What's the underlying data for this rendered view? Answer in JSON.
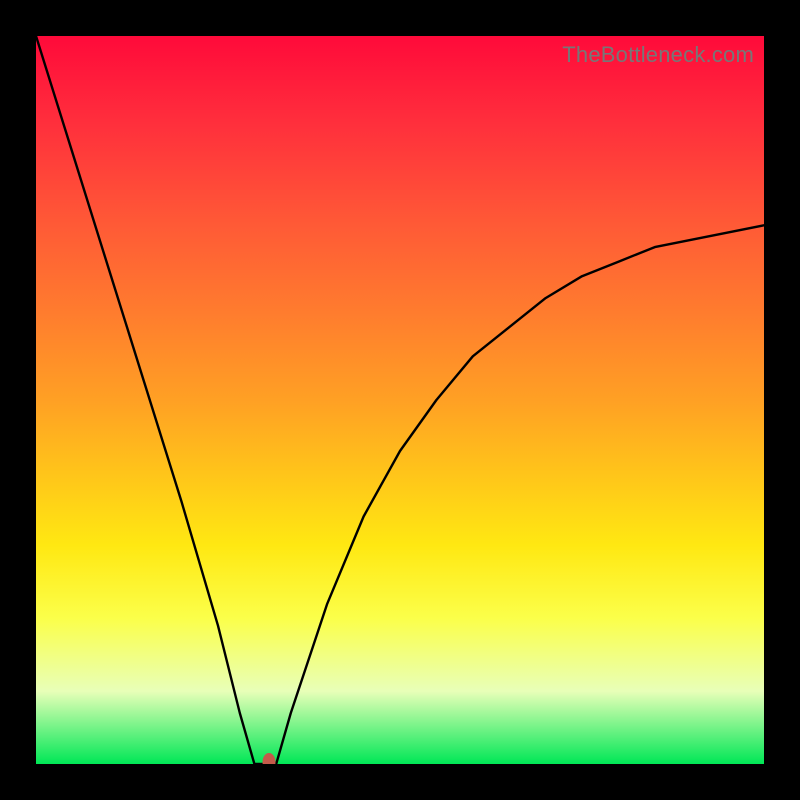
{
  "watermark": "TheBottleneck.com",
  "chart_data": {
    "type": "line",
    "title": "",
    "xlabel": "",
    "ylabel": "",
    "xlim": [
      0,
      1
    ],
    "ylim": [
      0,
      1
    ],
    "x": [
      0.0,
      0.05,
      0.1,
      0.15,
      0.2,
      0.25,
      0.28,
      0.3,
      0.31,
      0.33,
      0.35,
      0.4,
      0.45,
      0.5,
      0.55,
      0.6,
      0.65,
      0.7,
      0.75,
      0.8,
      0.85,
      0.9,
      0.95,
      1.0
    ],
    "y": [
      1.0,
      0.84,
      0.68,
      0.52,
      0.36,
      0.19,
      0.07,
      0.0,
      0.0,
      0.0,
      0.07,
      0.22,
      0.34,
      0.43,
      0.5,
      0.56,
      0.6,
      0.64,
      0.67,
      0.69,
      0.71,
      0.72,
      0.73,
      0.74
    ],
    "marker": {
      "x": 0.32,
      "y": 0.003
    },
    "gradient_colors": [
      "#ff0a3a",
      "#ff7c2e",
      "#ffe812",
      "#00e756"
    ]
  }
}
